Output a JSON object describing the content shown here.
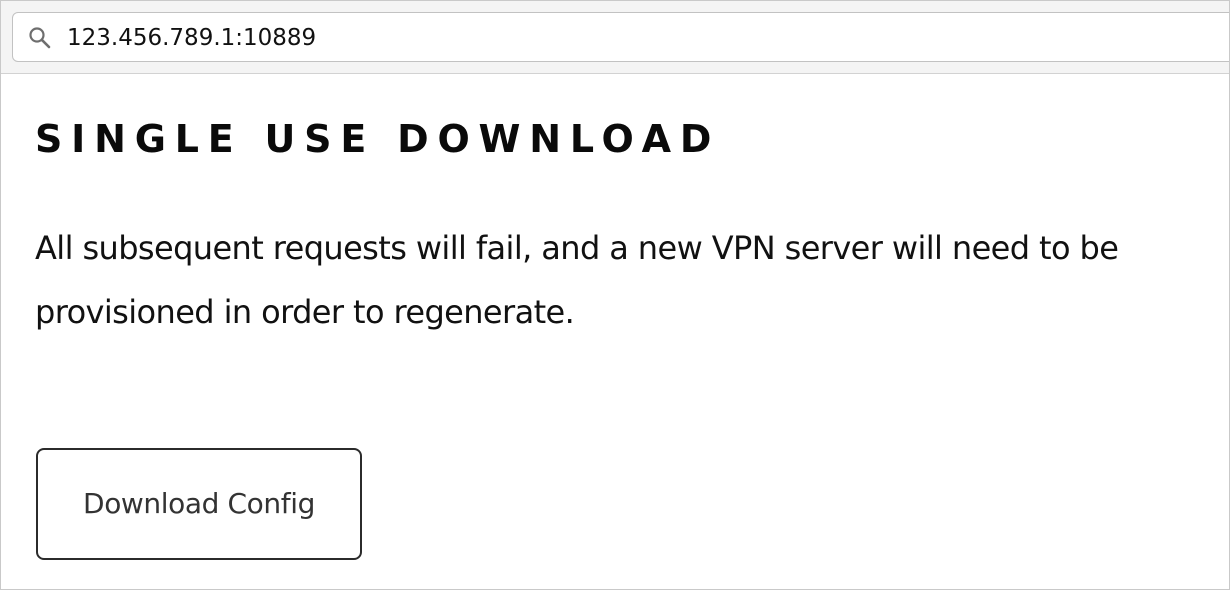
{
  "browser": {
    "address_bar": {
      "url": "123.456.789.1:10889",
      "icon": "search-icon"
    }
  },
  "page": {
    "title": "SINGLE USE DOWNLOAD",
    "description": "All subsequent requests will fail, and a new VPN server will need to be provisioned in order to regenerate.",
    "download_button_label": "Download Config"
  }
}
